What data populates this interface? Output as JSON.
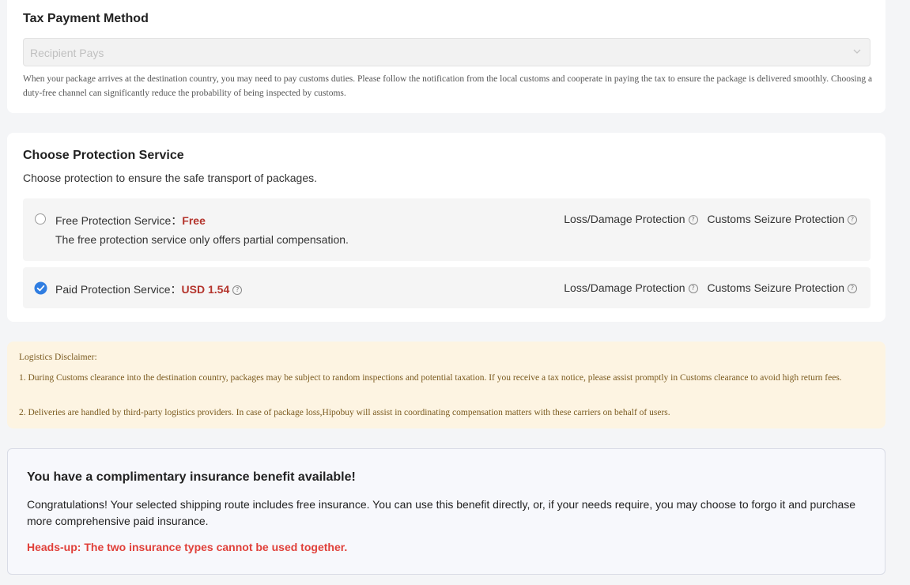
{
  "tax": {
    "title": "Tax Payment Method",
    "selected": "Recipient Pays",
    "note": "When your package arrives at the destination country, you may need to pay customs duties. Please follow the notification from the local customs and cooperate in paying the tax to ensure the package is delivered smoothly. Choosing a duty-free channel can significantly reduce the probability of being inspected by customs."
  },
  "protection": {
    "title": "Choose Protection Service",
    "subtitle": "Choose protection to ensure the safe transport of packages.",
    "free": {
      "label": "Free Protection Service：",
      "price": "Free",
      "description": "The free protection service only offers partial compensation.",
      "selected": false,
      "features": [
        "Loss/Damage Protection",
        "Customs Seizure Protection"
      ]
    },
    "paid": {
      "label": "Paid Protection Service：",
      "price": "USD 1.54",
      "selected": true,
      "features": [
        "Loss/Damage Protection",
        "Customs Seizure Protection"
      ]
    }
  },
  "disclaimer": {
    "title": "Logistics Disclaimer:",
    "lines": [
      "1. During Customs clearance into the destination country, packages may be subject to random inspections and potential taxation. If you receive a tax notice, please assist promptly in Customs clearance to avoid high return fees.",
      "2. Deliveries are handled by third-party logistics providers. In case of package loss,Hipobuy will assist in coordinating compensation matters with these carriers on behalf of users."
    ]
  },
  "insurance": {
    "title": "You have a complimentary insurance benefit available!",
    "body": "Congratulations! Your selected shipping route includes free insurance. You can use this benefit directly, or, if your needs require, you may choose to forgo it and purchase more comprehensive paid insurance.",
    "warning": "Heads-up: The two insurance types cannot be used together."
  },
  "colors": {
    "price": "#b4342c",
    "check": "#2f7de1",
    "warning": "#e0403a",
    "disclaimer_bg": "#fdf4e2"
  },
  "icons": {
    "chevron": "chevron-down-icon",
    "help": "question-circle-icon",
    "check": "check-circle-icon"
  }
}
